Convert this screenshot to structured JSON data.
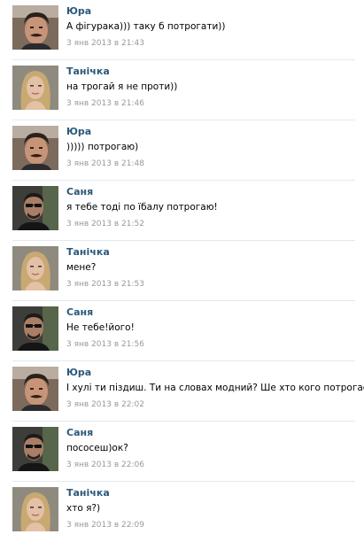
{
  "messages": [
    {
      "author": "Юра",
      "avatar": "yura-avatar",
      "text": "А фігурака))) таку б потрогати))",
      "time": "3 янв 2013 в 21:43"
    },
    {
      "author": "Танічка",
      "avatar": "tanichka-avatar",
      "text": "на трогай я не проти))",
      "time": "3 янв 2013 в 21:46"
    },
    {
      "author": "Юра",
      "avatar": "yura-avatar",
      "text": "))))) потрогаю)",
      "time": "3 янв 2013 в 21:48"
    },
    {
      "author": "Саня",
      "avatar": "sanya-avatar",
      "text": "я тебе тоді по їбалу потрогаю!",
      "time": "3 янв 2013 в 21:52"
    },
    {
      "author": "Танічка",
      "avatar": "tanichka-avatar",
      "text": "мене?",
      "time": "3 янв 2013 в 21:53"
    },
    {
      "author": "Саня",
      "avatar": "sanya-avatar",
      "text": "Не тебе!його!",
      "time": "3 янв 2013 в 21:56"
    },
    {
      "author": "Юра",
      "avatar": "yura-avatar",
      "text": "І хулі ти піздиш. Ти на словах модний? Ше хто кого потрогає.",
      "time": "3 янв 2013 в 22:02"
    },
    {
      "author": "Саня",
      "avatar": "sanya-avatar",
      "text": "пососеш)ок?",
      "time": "3 янв 2013 в 22:06"
    },
    {
      "author": "Танічка",
      "avatar": "tanichka-avatar",
      "text": "хто я?)",
      "time": "3 янв 2013 в 22:09"
    }
  ],
  "colors": {
    "author_link": "#2b587a",
    "message_text": "#000000",
    "timestamp": "#999999",
    "separator": "#e4e8ed"
  }
}
